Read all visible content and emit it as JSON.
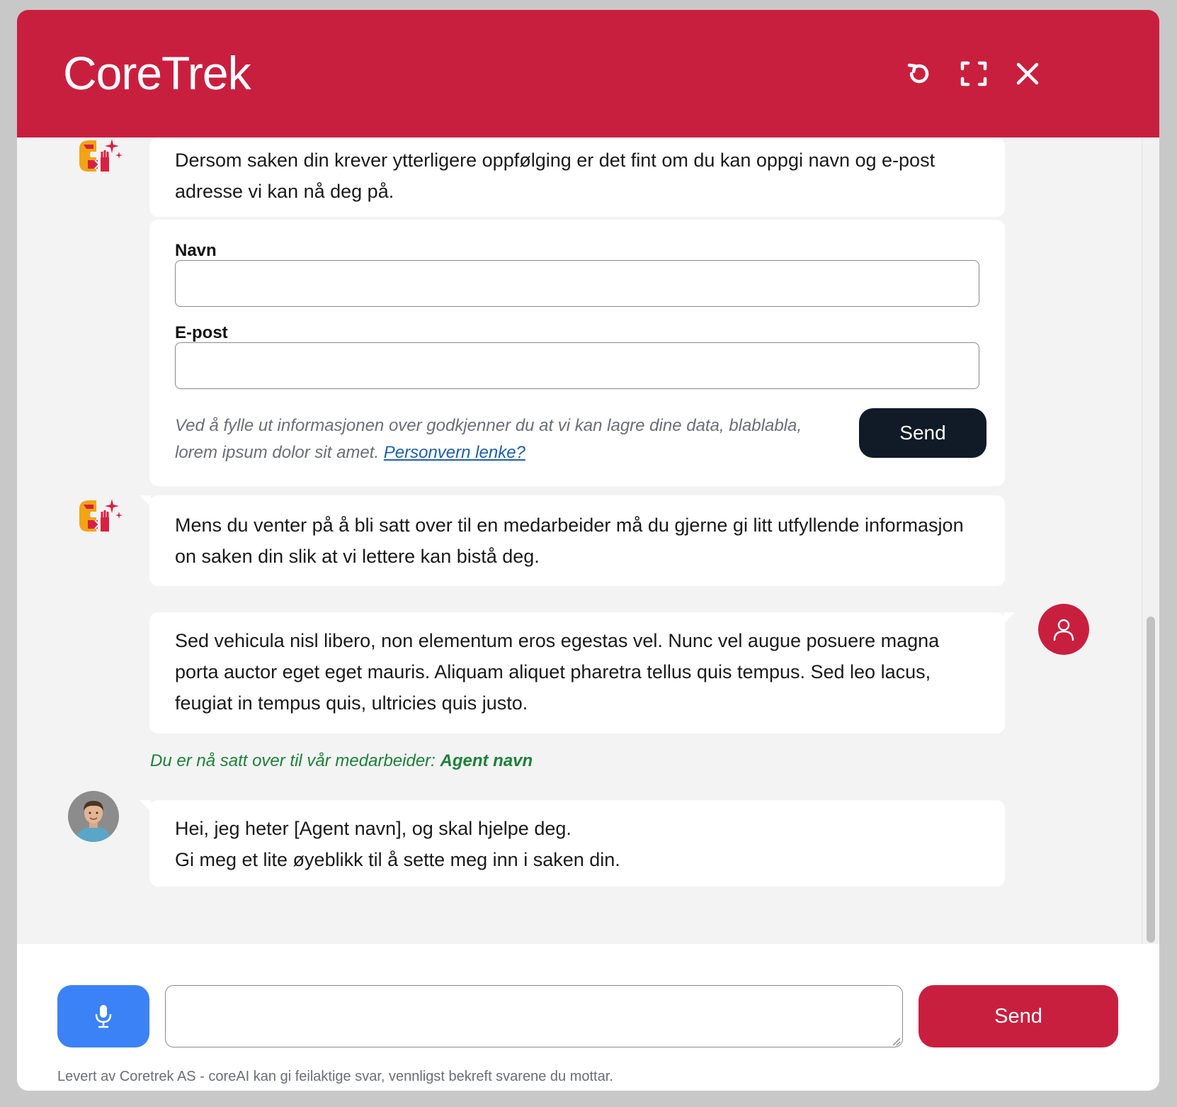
{
  "header": {
    "title": "CoreTrek",
    "restart_icon": "restart-icon",
    "fullscreen_icon": "fullscreen-icon",
    "close_icon": "close-icon"
  },
  "messages": {
    "bot_intro": "Dersom saken din krever ytterligere oppfølging er det fint om du kan oppgi navn og e-post adresse vi kan nå deg på.",
    "form": {
      "name_label": "Navn",
      "name_value": "",
      "email_label": "E-post",
      "email_value": "",
      "consent_text": "Ved å fylle ut informasjonen over godkjenner du at vi kan lagre dine data, blablabla, lorem ipsum dolor sit amet.",
      "privacy_link": "Personvern lenke?",
      "send_label": "Send"
    },
    "bot_wait": "Mens du venter på å bli satt over til en medarbeider må du gjerne gi litt utfyllende informasjon on saken din slik at vi lettere kan bistå deg.",
    "user_message": "Sed vehicula nisl libero, non elementum eros egestas vel. Nunc vel augue posuere magna porta auctor eget eget mauris. Aliquam aliquet pharetra tellus quis tempus. Sed leo lacus, feugiat in tempus quis, ultricies quis justo.",
    "handoff_prefix": "Du er nå satt over til vår medarbeider:",
    "handoff_agent": "Agent navn",
    "agent_line1": "Hei, jeg heter [Agent navn], og skal hjelpe deg.",
    "agent_line2": "Gi meg et lite øyeblikk til å sette meg inn i saken din."
  },
  "footer": {
    "input_value": "",
    "input_placeholder": "",
    "send_label": "Send",
    "disclaimer": "Levert av Coretrek AS - coreAI kan gi feilaktige svar, vennligst bekreft svarene du mottar."
  },
  "colors": {
    "brand": "#c91f3f",
    "mic": "#3b82f6",
    "form_button": "#111a27",
    "handoff": "#1d8138"
  }
}
